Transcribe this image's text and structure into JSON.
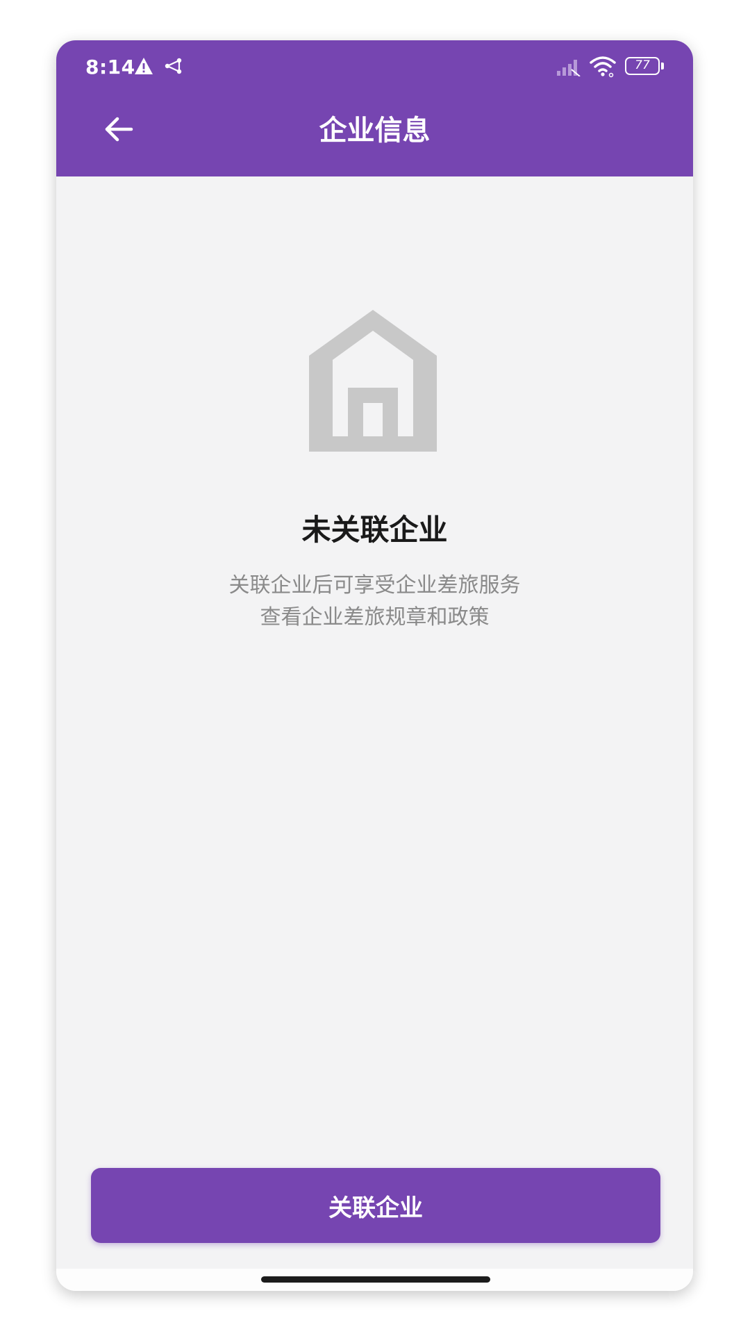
{
  "status_bar": {
    "time": "8:14",
    "battery_level": "77",
    "icons": [
      "warning-icon",
      "share-icon",
      "signal-icon",
      "wifi-icon",
      "battery-icon"
    ]
  },
  "app_bar": {
    "title": "企业信息",
    "back_icon": "arrow-left-icon"
  },
  "empty_state": {
    "icon": "house-icon",
    "title": "未关联企业",
    "description_line1": "关联企业后可享受企业差旅服务",
    "description_line2": "查看企业差旅规章和政策"
  },
  "actions": {
    "link_company_label": "关联企业"
  },
  "colors": {
    "primary": "#7645b1",
    "background": "#f3f3f4",
    "icon_gray": "#c8c8c8",
    "title_text": "#1a1a1a",
    "secondary_text": "#8a8a8a"
  }
}
